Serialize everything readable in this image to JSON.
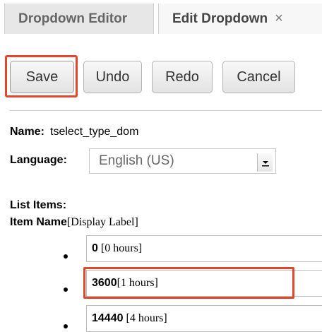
{
  "tabs": [
    {
      "label": "Dropdown Editor"
    },
    {
      "label": "Edit Dropdown",
      "close": "×"
    }
  ],
  "toolbar": {
    "save_label": "Save",
    "undo_label": "Undo",
    "redo_label": "Redo",
    "cancel_label": "Cancel"
  },
  "form": {
    "name_label": "Name:",
    "name_value": "tselect_type_dom",
    "language_label": "Language:",
    "language_value": "English (US)"
  },
  "list": {
    "title": "List Items:",
    "header_name": "Item Name",
    "header_display": "[Display Label]",
    "items": [
      {
        "name": "0",
        "display": "[0 hours]"
      },
      {
        "name": "3600",
        "display": "[1 hours]"
      },
      {
        "name": "14440",
        "display": "[4 hours]"
      }
    ]
  },
  "colors": {
    "highlight": "#e4462c"
  },
  "icons": {
    "tab_close": "close-icon",
    "select_arrow": "chevron-down-icon"
  }
}
